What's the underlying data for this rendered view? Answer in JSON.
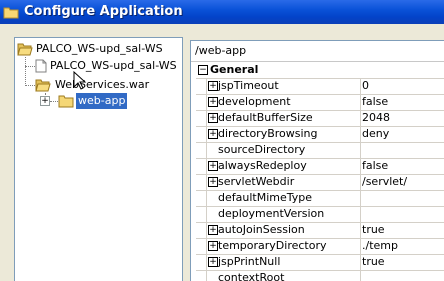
{
  "window": {
    "title": "Configure Application"
  },
  "tree": {
    "root": "PALCO_WS-upd_sal-WS",
    "file": "PALCO_WS-upd_sal-WS",
    "war": "WebServices.war",
    "selected": "web-app"
  },
  "properties": {
    "path": "/web-app",
    "category": "General",
    "rows": [
      {
        "name": "jspTimeout",
        "value": "0",
        "expandable": true
      },
      {
        "name": "development",
        "value": "false",
        "expandable": true
      },
      {
        "name": "defaultBufferSize",
        "value": "2048",
        "expandable": true
      },
      {
        "name": "directoryBrowsing",
        "value": "deny",
        "expandable": true
      },
      {
        "name": "sourceDirectory",
        "value": "",
        "expandable": false
      },
      {
        "name": "alwaysRedeploy",
        "value": "false",
        "expandable": true
      },
      {
        "name": "servletWebdir",
        "value": "/servlet/",
        "expandable": true
      },
      {
        "name": "defaultMimeType",
        "value": "",
        "expandable": false
      },
      {
        "name": "deploymentVersion",
        "value": "",
        "expandable": false
      },
      {
        "name": "autoJoinSession",
        "value": "true",
        "expandable": true
      },
      {
        "name": "temporaryDirectory",
        "value": "./temp",
        "expandable": true
      },
      {
        "name": "jspPrintNull",
        "value": "true",
        "expandable": true
      },
      {
        "name": "contextRoot",
        "value": "",
        "expandable": false
      }
    ]
  },
  "colors": {
    "titlebar": "#0a52d8",
    "selection": "#316ac5",
    "folder": "#f5d776"
  }
}
